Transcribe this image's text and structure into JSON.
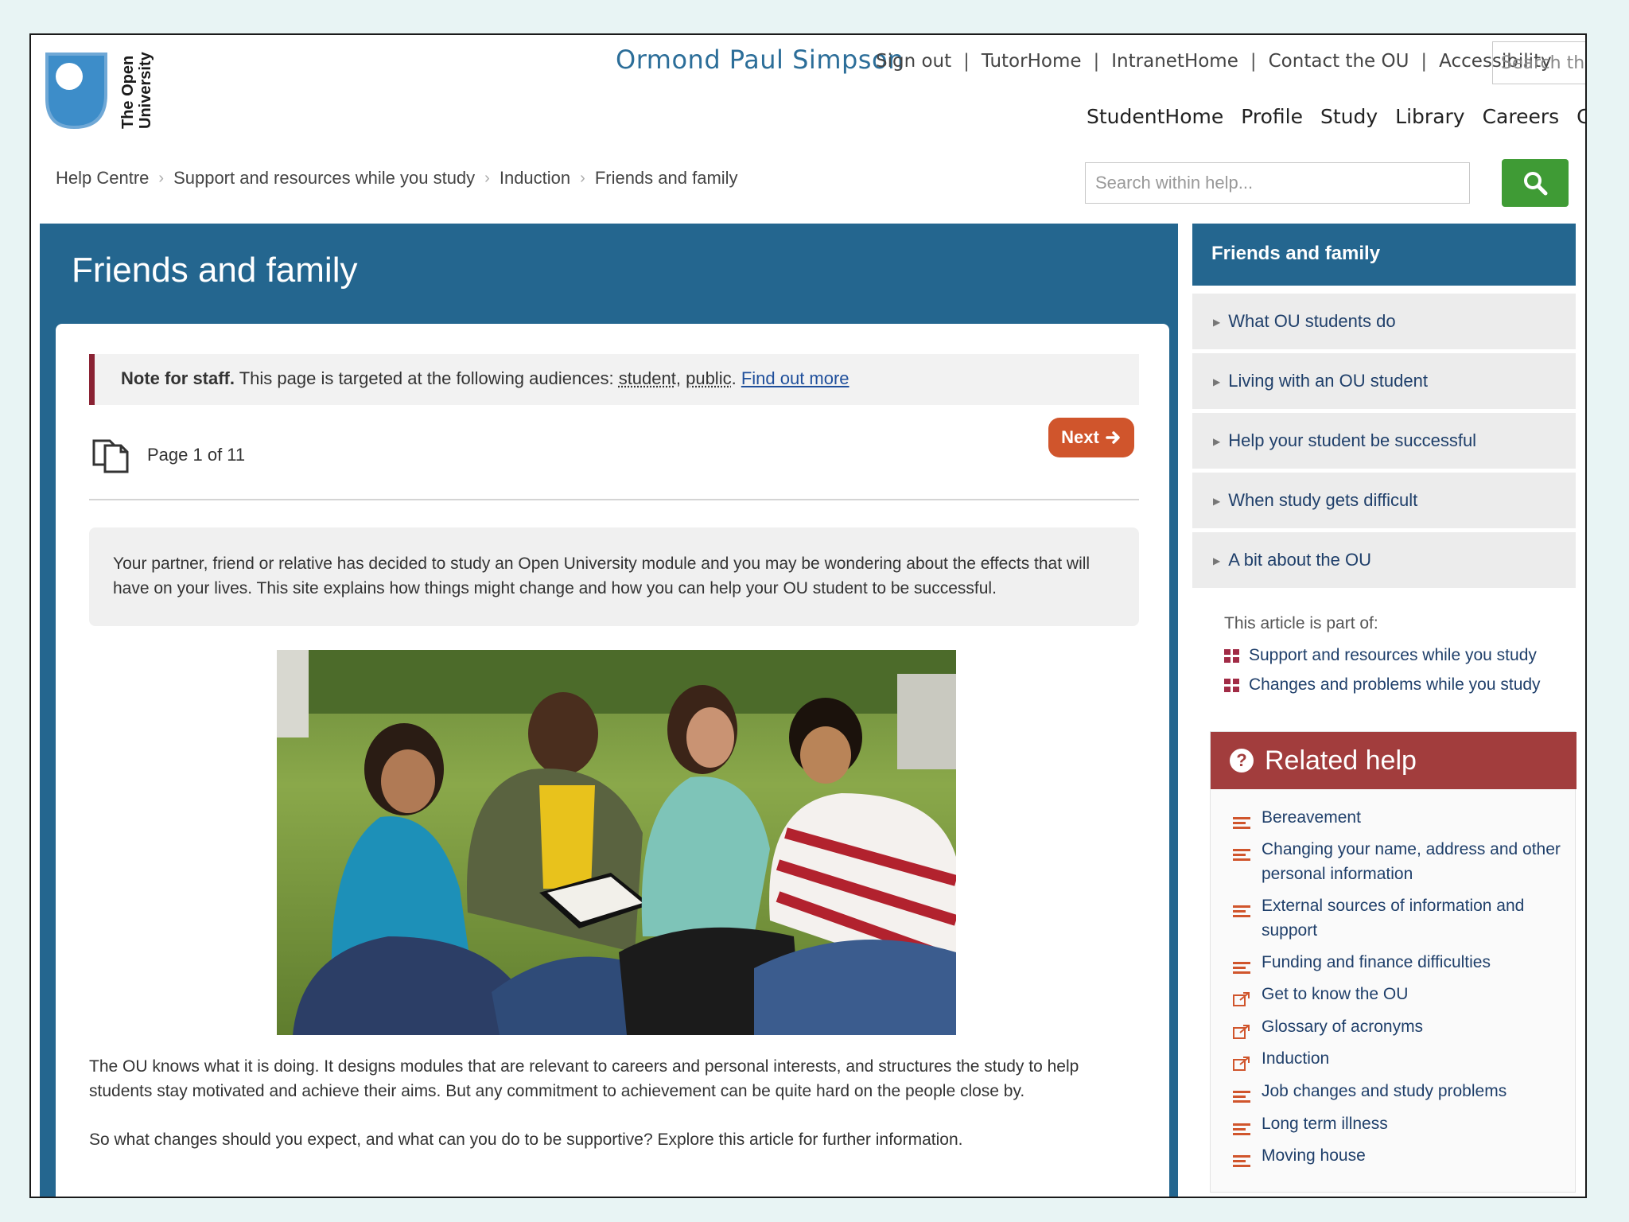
{
  "header": {
    "logo_text_line1": "The Open",
    "logo_text_line2": "University",
    "user_name": "Ormond Paul Simpson",
    "top_links": [
      "Sign out",
      "TutorHome",
      "IntranetHome",
      "Contact the OU",
      "Accessibility"
    ],
    "separator": "|",
    "top_search_placeholder": "Search the",
    "main_nav": [
      "StudentHome",
      "Profile",
      "Study",
      "Library",
      "Careers",
      "Communit"
    ]
  },
  "breadcrumb": [
    "Help Centre",
    "Support and resources while you study",
    "Induction",
    "Friends and family"
  ],
  "breadcrumb_sep": "›",
  "help_search": {
    "placeholder": "Search within help..."
  },
  "colors": {
    "blue": "#24668f",
    "green": "#3f9b35",
    "next": "#d0552c",
    "related": "#a23d3d",
    "accent": "#a12b46"
  },
  "page": {
    "title": "Friends and family",
    "staff_note_bold": "Note for staff.",
    "staff_note_text": " This page is targeted at the following audiences: ",
    "audience_1": "student",
    "audience_sep": ", ",
    "audience_2": "public",
    "audience_end": ". ",
    "find_out_more": "Find out more",
    "pager": "Page 1 of 11",
    "next_label": "Next",
    "intro": "Your partner, friend or relative has decided to study an Open University module and you may be wondering about the effects that will have on your lives. This site explains how things might change and how you can help your OU student to be successful.",
    "para1": "The OU knows what it is doing. It designs modules that are relevant to careers and personal interests, and structures the study to help students stay motivated and achieve their aims. But any commitment to achievement can be quite hard on the people close by.",
    "para2": "So what changes should you expect, and what can you do to be supportive? Explore this article for further information."
  },
  "sidebar": {
    "heading": "Friends and family",
    "items": [
      "What OU students do",
      "Living with an OU student",
      "Help your student be successful",
      "When study gets difficult",
      "A bit about the OU"
    ],
    "part_of_label": "This article is part of:",
    "part_of_links": [
      "Support and resources while you study",
      "Changes and problems while you study"
    ]
  },
  "related": {
    "heading": "Related help",
    "items": [
      {
        "label": "Bereavement",
        "icon": "list-icon"
      },
      {
        "label": "Changing your name, address and other personal information",
        "icon": "list-icon"
      },
      {
        "label": "External sources of information and support",
        "icon": "list-icon"
      },
      {
        "label": "Funding and finance difficulties",
        "icon": "list-icon"
      },
      {
        "label": "Get to know the OU",
        "icon": "external-link-icon"
      },
      {
        "label": "Glossary of acronyms",
        "icon": "external-link-icon"
      },
      {
        "label": "Induction",
        "icon": "external-link-icon"
      },
      {
        "label": "Job changes and study problems",
        "icon": "list-icon"
      },
      {
        "label": "Long term illness",
        "icon": "list-icon"
      },
      {
        "label": "Moving house",
        "icon": "list-icon"
      }
    ]
  }
}
